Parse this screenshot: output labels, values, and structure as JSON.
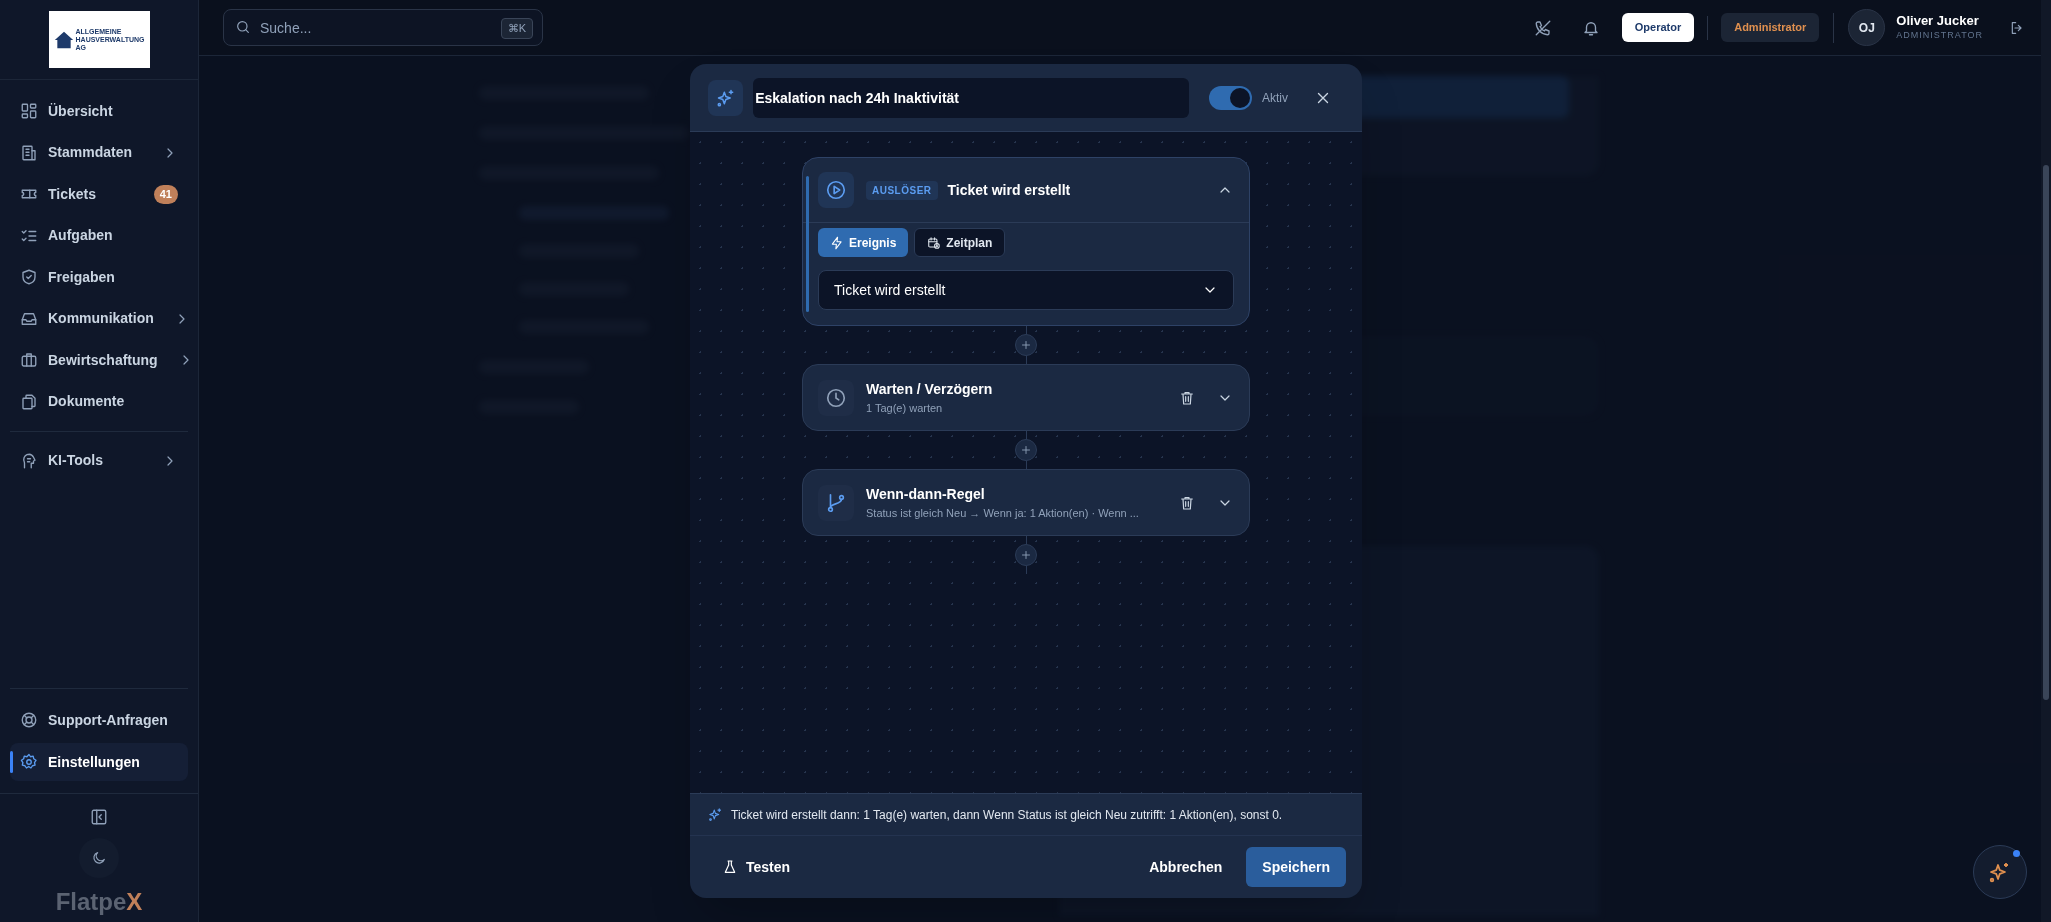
{
  "sidebar": {
    "logo": {
      "lines": [
        "ALLGEMEINE",
        "HAUSVERWALTUNG",
        "AG"
      ]
    },
    "items": [
      {
        "label": "Übersicht",
        "expandable": false,
        "selected": false
      },
      {
        "label": "Stammdaten",
        "expandable": true,
        "selected": false
      },
      {
        "label": "Tickets",
        "expandable": false,
        "selected": false,
        "badge": "41"
      },
      {
        "label": "Aufgaben",
        "expandable": false,
        "selected": false
      },
      {
        "label": "Freigaben",
        "expandable": false,
        "selected": false
      },
      {
        "label": "Kommunikation",
        "expandable": true,
        "selected": false
      },
      {
        "label": "Bewirtschaftung",
        "expandable": true,
        "selected": false
      },
      {
        "label": "Dokumente",
        "expandable": false,
        "selected": false
      }
    ],
    "tools": [
      {
        "label": "KI-Tools",
        "expandable": true,
        "selected": false
      }
    ],
    "bottom_items": [
      {
        "label": "Support-Anfragen",
        "selected": false
      },
      {
        "label": "Einstellungen",
        "selected": true
      }
    ],
    "brand": {
      "text": "Flatpe",
      "accent": "X"
    }
  },
  "top_bar": {
    "search": {
      "placeholder": "Suche...",
      "shortcut": "⌘K"
    },
    "roles": [
      {
        "label": "Operator",
        "selected": true
      },
      {
        "label": "Administrator",
        "selected": false
      }
    ],
    "user": {
      "initials": "OJ",
      "name": "Oliver Jucker",
      "role": "ADMINISTRATOR"
    }
  },
  "dialog": {
    "title_value": "Eskalation nach 24h Inaktivität",
    "active": {
      "on": true,
      "label": "Aktiv"
    },
    "steps": [
      {
        "kind": "trigger",
        "badge": "AUSLÖSER",
        "title": "Ticket wird erstellt",
        "expanded": true,
        "modes": [
          {
            "label": "Ereignis",
            "selected": true
          },
          {
            "label": "Zeitplan",
            "selected": false
          }
        ],
        "select_value": "Ticket wird erstellt"
      },
      {
        "kind": "delay",
        "title": "Warten / Verzögern",
        "subtitle": "1 Tag(e) warten",
        "expanded": false
      },
      {
        "kind": "condition",
        "title": "Wenn-dann-Regel",
        "subtitle": "Status ist gleich Neu → Wenn ja: 1 Aktion(en) · Wenn ...",
        "expanded": false
      }
    ],
    "summary": "Ticket wird erstellt dann: 1 Tag(e) warten, dann Wenn Status ist gleich Neu zutrifft: 1 Aktion(en), sonst 0.",
    "test_button": "Testen",
    "cancel_button": "Abbrechen",
    "save_button": "Speichern"
  }
}
